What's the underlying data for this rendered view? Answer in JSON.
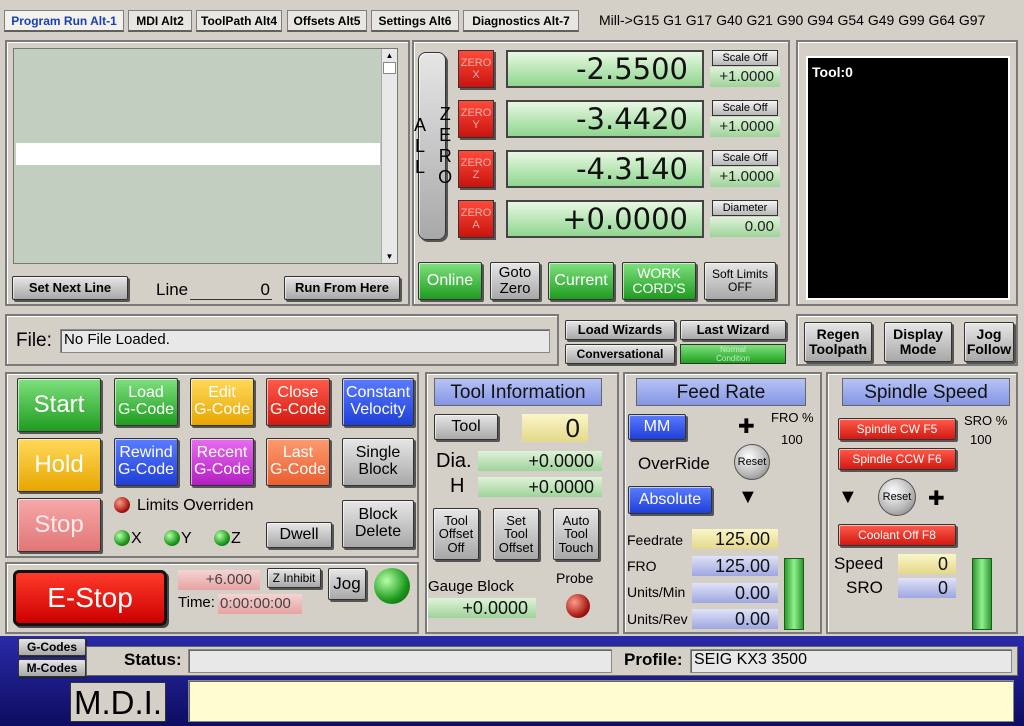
{
  "tabs": [
    {
      "label": "Program Run Alt-1"
    },
    {
      "label": "MDI Alt2"
    },
    {
      "label": "ToolPath Alt4"
    },
    {
      "label": "Offsets Alt5"
    },
    {
      "label": "Settings Alt6"
    },
    {
      "label": "Diagnostics Alt-7"
    }
  ],
  "gcode_modes": "Mill->G15  G1 G17 G40 G21 G90 G94 G54 G49 G99 G64 G97",
  "gcode_view": {
    "set_next_line": "Set Next Line",
    "line_label": "Line",
    "line_value": "0",
    "run_from_here": "Run From Here"
  },
  "dro": {
    "zero_all": "ZERO\nALL",
    "axes": [
      {
        "zero_label": "ZERO\nX",
        "value": "-2.5500",
        "scale_label": "Scale Off",
        "scale_value": "+1.0000"
      },
      {
        "zero_label": "ZERO\nY",
        "value": "-3.4420",
        "scale_label": "Scale Off",
        "scale_value": "+1.0000"
      },
      {
        "zero_label": "ZERO\nZ",
        "value": "-4.3140",
        "scale_label": "Scale Off",
        "scale_value": "+1.0000"
      },
      {
        "zero_label": "ZERO\nA",
        "value": "+0.0000",
        "scale_label": "Diameter",
        "scale_value": "0.00"
      }
    ],
    "buttons": {
      "online": "Online",
      "goto_zero": "Goto\nZero",
      "current": "Current",
      "work_coords": "WORK\nCORD'S",
      "soft_limits": "Soft Limits\nOFF"
    }
  },
  "tool_display": {
    "text": "Tool:0"
  },
  "file": {
    "label": "File:",
    "value": "No File Loaded.",
    "load_wizards": "Load Wizards",
    "last_wizard": "Last Wizard",
    "conversational": "Conversational",
    "normal_condition": "Normal\nCondition",
    "regen_toolpath": "Regen\nToolpath",
    "display_mode": "Display\nMode",
    "jog_follow": "Jog\nFollow"
  },
  "program_controls": {
    "start": "Start",
    "load_gcode": "Load\nG-Code",
    "edit_gcode": "Edit\nG-Code",
    "close_gcode": "Close\nG-Code",
    "constant_velocity": "Constant\nVelocity",
    "hold": "Hold",
    "rewind_gcode": "Rewind\nG-Code",
    "recent_gcode": "Recent\nG-Code",
    "last_gcode": "Last\nG-Code",
    "single_block": "Single\nBlock",
    "stop": "Stop",
    "limits_overriden": "Limits Overriden",
    "axis_x": "X",
    "axis_y": "Y",
    "axis_z": "Z",
    "dwell": "Dwell",
    "block_delete": "Block\nDelete"
  },
  "estop": {
    "label": "E-Stop",
    "z_inhibit_value": "+6.000",
    "z_inhibit": "Z Inhibit",
    "jog": "Jog",
    "time_label": "Time:",
    "time_value": "0:00:00:00"
  },
  "tool_info": {
    "title": "Tool Information",
    "tool_button": "Tool",
    "tool_value": "0",
    "dia_label": "Dia.",
    "dia_value": "+0.0000",
    "h_label": "H",
    "h_value": "+0.0000",
    "tool_offset_off": "Tool\nOffset\nOff",
    "set_tool_offset": "Set\nTool\nOffset",
    "auto_tool_touch": "Auto\nTool\nTouch",
    "gauge_block_label": "Gauge Block",
    "gauge_block_value": "+0.0000",
    "probe_label": "Probe"
  },
  "feed_rate": {
    "title": "Feed Rate",
    "mm": "MM",
    "fro_label": "FRO %",
    "fro_percent": "100",
    "override": "OverRide",
    "reset": "Reset",
    "absolute": "Absolute",
    "feedrate_label": "Feedrate",
    "feedrate_value": "125.00",
    "fro_row_label": "FRO",
    "fro_value": "125.00",
    "units_min_label": "Units/Min",
    "units_min_value": "0.00",
    "units_rev_label": "Units/Rev",
    "units_rev_value": "0.00"
  },
  "spindle": {
    "title": "Spindle Speed",
    "cw": "Spindle CW F5",
    "ccw": "Spindle CCW F6",
    "sro_label": "SRO %",
    "sro_percent": "100",
    "reset": "Reset",
    "coolant": "Coolant Off F8",
    "speed_label": "Speed",
    "speed_value": "0",
    "sro_row_label": "SRO",
    "sro_value": "0"
  },
  "bottom": {
    "gcodes": "G-Codes",
    "mcodes": "M-Codes",
    "status_label": "Status:",
    "status_value": "",
    "profile_label": "Profile:",
    "profile_value": "SEIG KX3 3500",
    "mdi_label": "M.D.I.",
    "mdi_value": ""
  }
}
